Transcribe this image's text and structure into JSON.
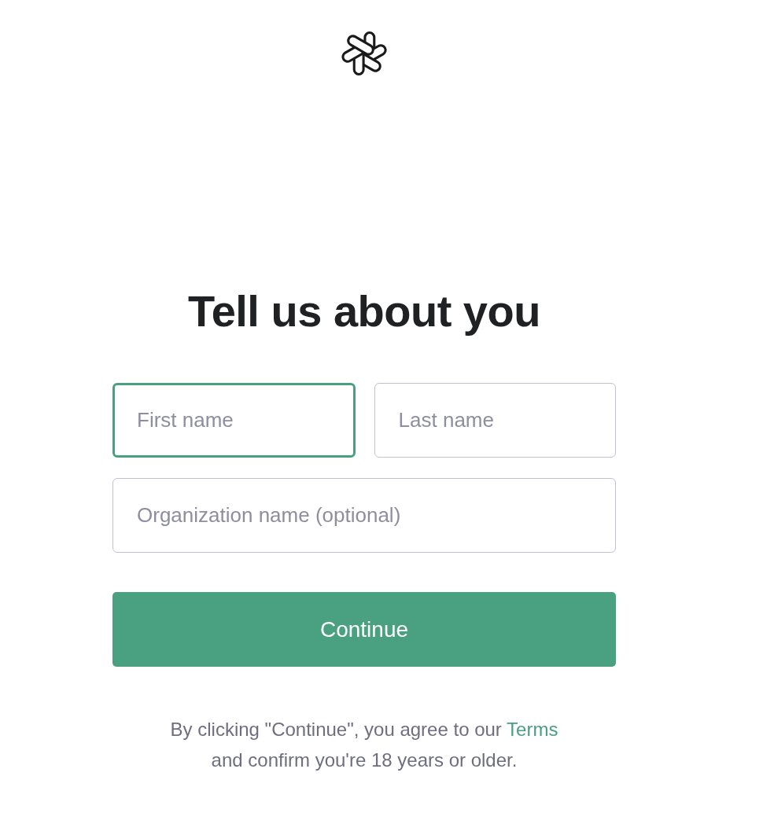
{
  "heading": "Tell us about you",
  "rows": [
    {
      "fields": [
        {
          "placeholder": "First name",
          "focused": true
        },
        {
          "placeholder": "Last name",
          "focused": false
        }
      ]
    },
    {
      "fields": [
        {
          "placeholder": "Organization name (optional)",
          "focused": false
        }
      ]
    }
  ],
  "button": {
    "label": "Continue"
  },
  "agreement": {
    "text": "By clicking \"Continue\", you agree to our",
    "link": "Terms",
    "text_after": "and confirm you're 18 years or older."
  }
}
